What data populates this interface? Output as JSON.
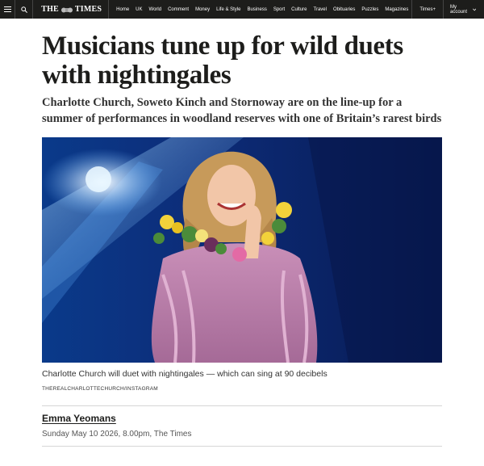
{
  "nav": {
    "menu_icon": "hamburger-menu-icon",
    "search_icon": "search-icon",
    "logo_left": "THE",
    "logo_right": "TIMES",
    "links": [
      "Home",
      "UK",
      "World",
      "Comment",
      "Money",
      "Life & Style",
      "Business",
      "Sport",
      "Culture",
      "Travel",
      "Obituaries",
      "Puzzles",
      "Magazines"
    ],
    "times_plus": "Times+",
    "account": "My account",
    "background": "#1d1d1b"
  },
  "article": {
    "headline": "Musicians tune up for wild duets with nightingales",
    "standfirst": "Charlotte Church, Soweto Kinch and Stornoway are on the line-up for a summer of performances in woodland reserves with one of Britain’s rarest birds",
    "image": {
      "caption": "Charlotte Church will duet with nightingales — which can sing at 90 decibels",
      "credit": "THEREALCHARLOTTECHURCH/INSTAGRAM"
    },
    "byline": {
      "author": "Emma Yeomans",
      "dateline": "Sunday May 10 2026, 8.00pm, The Times"
    }
  }
}
